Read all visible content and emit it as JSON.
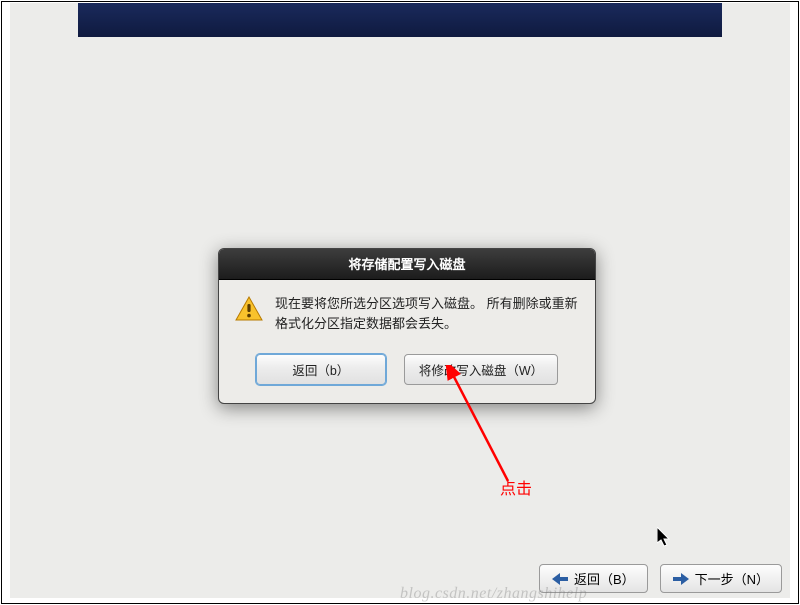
{
  "dialog": {
    "title": "将存储配置写入磁盘",
    "message": "现在要将您所选分区选项写入磁盘。 所有删除或重新格式化分区指定数据都会丢失。",
    "back_label": "返回（b）",
    "write_label": "将修改写入磁盘（W）"
  },
  "footer": {
    "back_label": "返回（B）",
    "next_label": "下一步（N）"
  },
  "annotation": {
    "label": "点击"
  },
  "watermark": "blog.csdn.net/zhangshihelp",
  "icons": {
    "warning": "warning-icon",
    "arrow_left": "arrow-left-icon",
    "arrow_right": "arrow-right-icon"
  }
}
